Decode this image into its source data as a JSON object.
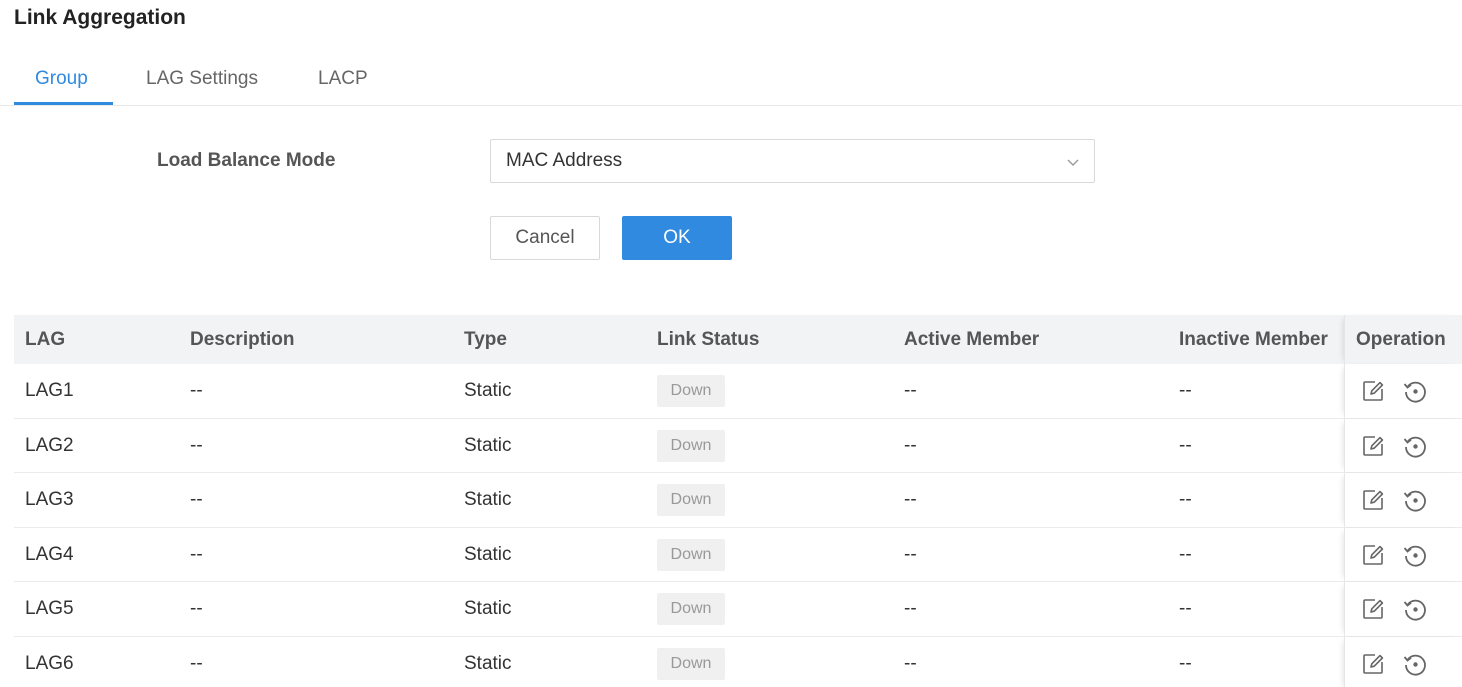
{
  "page": {
    "title": "Link Aggregation"
  },
  "tabs": [
    {
      "label": "Group",
      "active": true
    },
    {
      "label": "LAG Settings",
      "active": false
    },
    {
      "label": "LACP",
      "active": false
    }
  ],
  "form": {
    "load_balance_label": "Load Balance Mode",
    "load_balance_value": "MAC Address",
    "cancel_label": "Cancel",
    "ok_label": "OK"
  },
  "table": {
    "columns": [
      "LAG",
      "Description",
      "Type",
      "Link Status",
      "Active Member",
      "Inactive Member",
      "Operation"
    ],
    "rows": [
      {
        "lag": "LAG1",
        "description": "--",
        "type": "Static",
        "status": "Down",
        "active": "--",
        "inactive": "--"
      },
      {
        "lag": "LAG2",
        "description": "--",
        "type": "Static",
        "status": "Down",
        "active": "--",
        "inactive": "--"
      },
      {
        "lag": "LAG3",
        "description": "--",
        "type": "Static",
        "status": "Down",
        "active": "--",
        "inactive": "--"
      },
      {
        "lag": "LAG4",
        "description": "--",
        "type": "Static",
        "status": "Down",
        "active": "--",
        "inactive": "--"
      },
      {
        "lag": "LAG5",
        "description": "--",
        "type": "Static",
        "status": "Down",
        "active": "--",
        "inactive": "--"
      },
      {
        "lag": "LAG6",
        "description": "--",
        "type": "Static",
        "status": "Down",
        "active": "--",
        "inactive": "--"
      }
    ]
  },
  "icons": {
    "dropdown": "chevron-down-icon",
    "edit": "edit-icon",
    "reset": "reset-icon"
  },
  "colors": {
    "accent": "#2f8ae0",
    "status_down_bg": "#f0f0f0"
  }
}
